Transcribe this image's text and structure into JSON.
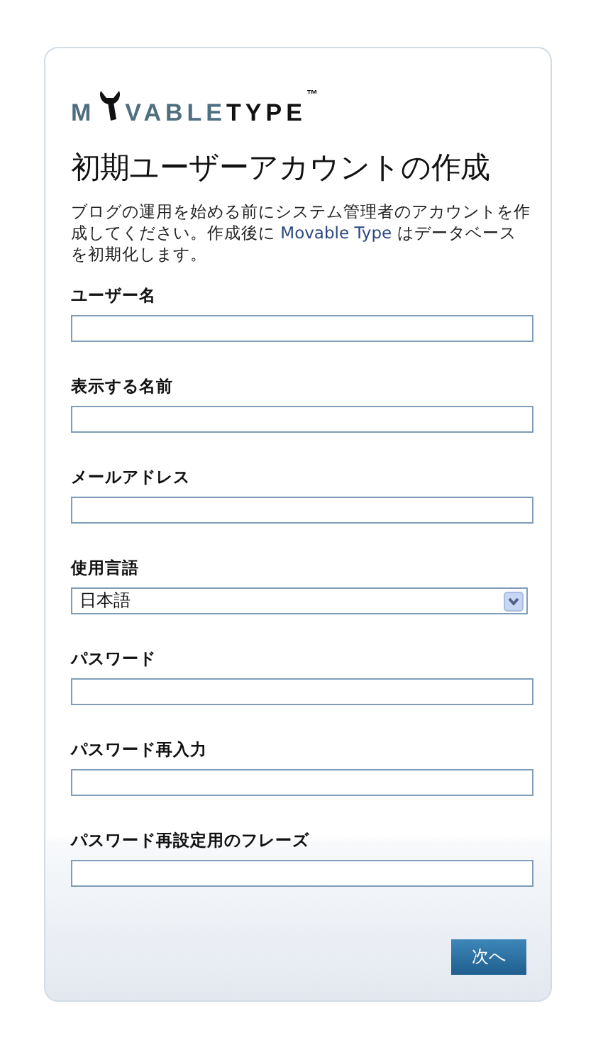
{
  "logo": {
    "first": "M",
    "middle": "VABLE",
    "last": "TYPE",
    "mark": "™"
  },
  "title": "初期ユーザーアカウントの作成",
  "intro": {
    "before": "ブログの運用を始める前にシステム管理者のアカウントを作成してください。作成後に ",
    "link": "Movable Type",
    "after": " はデータベースを初期化します。"
  },
  "fields": [
    {
      "kind": "text",
      "label": "ユーザー名"
    },
    {
      "kind": "text",
      "label": "表示する名前"
    },
    {
      "kind": "text",
      "label": "メールアドレス"
    },
    {
      "kind": "select",
      "label": "使用言語",
      "value": "日本語"
    },
    {
      "kind": "text",
      "label": "パスワード"
    },
    {
      "kind": "text",
      "label": "パスワード再入力"
    },
    {
      "kind": "text",
      "label": "パスワード再設定用のフレーズ"
    }
  ],
  "next_button": "次へ"
}
